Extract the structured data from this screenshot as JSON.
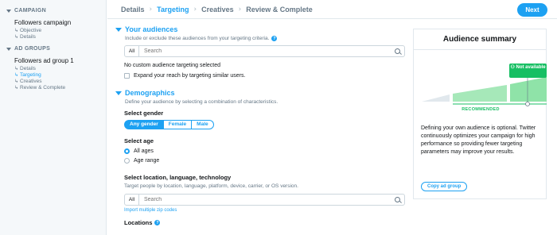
{
  "sidebar": {
    "campaign_heading": "CAMPAIGN",
    "campaign_name": "Followers campaign",
    "campaign_items": [
      "Objective",
      "Details"
    ],
    "adgroups_heading": "AD GROUPS",
    "adgroup_name": "Followers ad group 1",
    "adgroup_items": [
      "Details",
      "Targeting",
      "Creatives",
      "Review & Complete"
    ]
  },
  "topbar": {
    "steps": [
      "Details",
      "Targeting",
      "Creatives",
      "Review & Complete"
    ],
    "next_label": "Next"
  },
  "audiences": {
    "title": "Your audiences",
    "description": "Include or exclude these audiences from your targeting criteria.",
    "search_all": "All",
    "search_placeholder": "Search",
    "none_text": "No custom audience targeting selected",
    "expand_label": "Expand your reach by targeting similar users."
  },
  "demographics": {
    "title": "Demographics",
    "description": "Define your audience by selecting a combination of characteristics.",
    "gender_label": "Select gender",
    "gender_options": [
      "Any gender",
      "Female",
      "Male"
    ],
    "age_label": "Select age",
    "age_options": [
      "All ages",
      "Age range"
    ],
    "location_label": "Select location, language, technology",
    "location_desc": "Target people by location, language, platform, device, carrier, or OS version.",
    "search_all": "All",
    "search_placeholder": "Search",
    "zip_link": "Import multiple zip codes",
    "locations_label": "Locations"
  },
  "summary": {
    "title": "Audience summary",
    "not_available": "Not available",
    "recommended": "RECOMMENDED",
    "description": "Defining your own audience is optional. Twitter continuously optimizes your campaign for high performance so providing fewer targeting parameters may improve your results.",
    "copy_label": "Copy ad group"
  },
  "colors": {
    "accent": "#1da1f2",
    "success": "#17bf63",
    "muted": "#657786"
  },
  "icons": [
    "search-icon",
    "question-icon",
    "person-icon",
    "chevron-right-icon",
    "caret-down-icon",
    "return-arrow-icon"
  ]
}
